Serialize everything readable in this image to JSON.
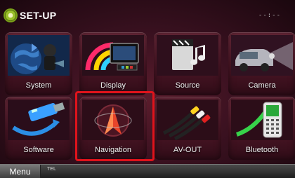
{
  "header": {
    "title": "SET-UP",
    "clock": "--:--"
  },
  "tiles": [
    {
      "label": "System",
      "icon": "globe-icon"
    },
    {
      "label": "Display",
      "icon": "display-icon"
    },
    {
      "label": "Source",
      "icon": "source-icon"
    },
    {
      "label": "Camera",
      "icon": "camera-icon"
    },
    {
      "label": "Software",
      "icon": "usb-icon"
    },
    {
      "label": "Navigation",
      "icon": "navigation-icon"
    },
    {
      "label": "AV-OUT",
      "icon": "av-cable-icon"
    },
    {
      "label": "Bluetooth",
      "icon": "phone-icon"
    }
  ],
  "bottom": {
    "menu_label": "Menu",
    "tel_label": "TEL"
  },
  "colors": {
    "highlight": "#e0131b",
    "background": "#3a1120"
  }
}
